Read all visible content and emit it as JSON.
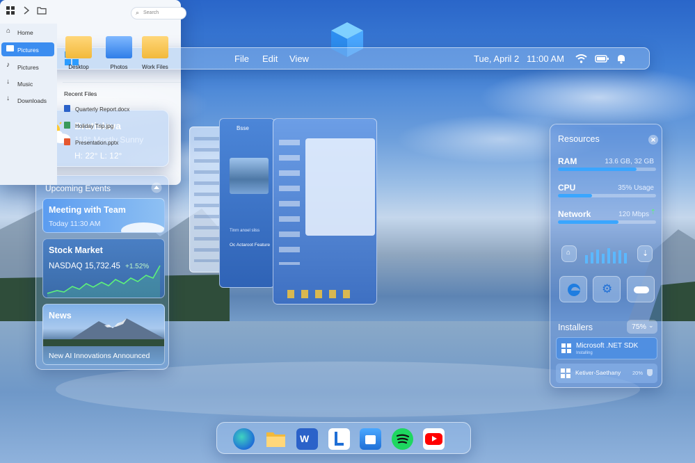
{
  "topbar": {
    "menu": [
      "File",
      "Edit",
      "View"
    ],
    "date": "Tue, April 2",
    "time": "11:00 AM"
  },
  "weather": {
    "city": "Bratislava",
    "condition": "118° Mostly Sunny",
    "hilo": "H: 22° L: 12°"
  },
  "events": {
    "header": "Upcoming Events",
    "meeting": {
      "title": "Meeting with Team",
      "time": "Today 11:30 AM"
    },
    "stock": {
      "title": "Stock Market",
      "ticker": "NASDAQ 15,732.45",
      "change": "+1.52%"
    },
    "news": {
      "title": "News",
      "headline": "New AI Innovations Announced"
    }
  },
  "explorer": {
    "search": "Search",
    "nav": [
      "Home",
      "Pictures",
      "Pictures",
      "Music",
      "Downloads"
    ],
    "folders": [
      "Desktop",
      "Photos",
      "Work Files"
    ],
    "recent_header": "Recent Files",
    "recent": [
      "Quarterly Report.docx",
      "Holiday Trip.jpg",
      "Presentation.pptx"
    ]
  },
  "back_window": {
    "title": "Bsse",
    "footer1": "Tinrn anoel sliss",
    "footer2": "Oc Actaroot Feature"
  },
  "resources": {
    "title": "Resources",
    "ram": {
      "label": "RAM",
      "value": "13.6 GB, 32 GB",
      "level": 0.8
    },
    "cpu": {
      "label": "CPU",
      "value": "35% Usage",
      "level": 0.35
    },
    "net": {
      "label": "Network",
      "value": "120 Mbps",
      "level": 0.62
    },
    "installers": {
      "label": "Installers",
      "percent": "75%",
      "items": [
        {
          "name": "Microsoft .NET SDK",
          "sub": "Installing"
        },
        {
          "name": "Ketiver-Saethany",
          "pct": "20%"
        }
      ]
    }
  },
  "dock": {
    "apps": [
      "edge-icon",
      "file-explorer-icon",
      "word-icon",
      "office-icon",
      "store-icon",
      "spotify-icon",
      "youtube-icon"
    ]
  },
  "colors": {
    "accent": "#3aa6ff",
    "green": "#5ef27a"
  }
}
